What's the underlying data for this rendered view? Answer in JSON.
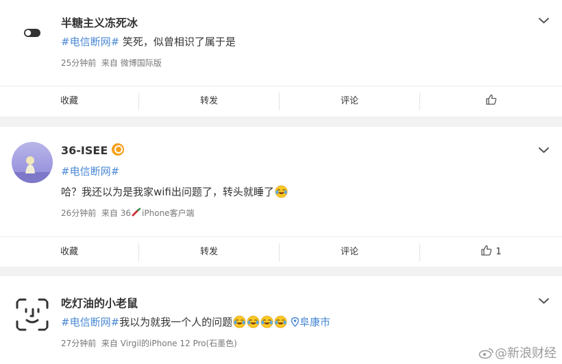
{
  "posts": [
    {
      "author": "半糖主义冻死冰",
      "hashtag": "#电信断网#",
      "text": " 笑死，似曾相识了属于是",
      "time": "25分钟前",
      "source_prefix": "来自",
      "source": "微博国际版",
      "actions": {
        "favorite": "收藏",
        "repost": "转发",
        "comment": "评论",
        "like_count": ""
      }
    },
    {
      "author": "36-ISEE",
      "verified": true,
      "hashtag": "#电信断网#",
      "text": "哈？我还以为是我家wifi出问题了，转头就睡了",
      "time": "26分钟前",
      "source_prefix": "来自",
      "source_a": "36",
      "source_b": "iPhone客户端",
      "actions": {
        "favorite": "收藏",
        "repost": "转发",
        "comment": "评论",
        "like_count": "1"
      }
    },
    {
      "author": "吃灯油的小老鼠",
      "hashtag": "#电信断网#",
      "text": "我以为就我一个人的问题",
      "location": "阜康市",
      "time": "27分钟前",
      "source_prefix": "来自",
      "source": "Virgil的iPhone 12 Pro(石墨色)"
    }
  ],
  "watermark": "@新浪财经",
  "colors": {
    "link": "#4a88d3",
    "verified": "#f7a11b",
    "background": "#f2f2f2"
  }
}
